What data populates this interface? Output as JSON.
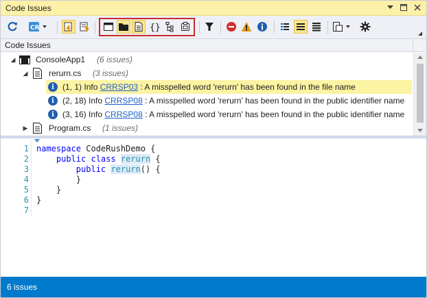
{
  "window": {
    "title": "Code Issues",
    "title_buttons": [
      "dropdown-arrow-icon",
      "maximize-icon",
      "close-icon"
    ]
  },
  "toolbar": {
    "buttons": [
      "refresh-icon",
      "cr-menu-icon",
      "highlight-issues-icon",
      "highlight-file-issues-icon",
      "scope-solution-icon",
      "scope-folder-icon",
      "scope-file-icon",
      "scope-braces-icon",
      "scope-hierarchy-icon",
      "scope-project-icon",
      "filter-icon",
      "error-icon",
      "warning-icon",
      "info-icon",
      "group-by-file-icon",
      "group-by-type-icon",
      "group-flat-icon",
      "export-icon",
      "settings-icon"
    ],
    "accent_active": "#fce58d",
    "accent_scope_box": "#c92b2b"
  },
  "header": {
    "label": "Code Issues"
  },
  "tree": {
    "project": {
      "name": "ConsoleApp1",
      "count": "(6 issues)"
    },
    "files": [
      {
        "name": "rerurn.cs",
        "count": "(3 issues)",
        "expanded": true,
        "issues": [
          {
            "pos": "(1, 1)",
            "severity": "Info",
            "code": "CRRSP03",
            "message": ": A misspelled word 'rerurn' has been found in the file name",
            "selected": true
          },
          {
            "pos": "(2, 18)",
            "severity": "Info",
            "code": "CRRSP08",
            "message": ": A misspelled word 'rerurn' has been found in the public identifier name",
            "selected": false
          },
          {
            "pos": "(3, 16)",
            "severity": "Info",
            "code": "CRRSP08",
            "message": ": A misspelled word 'rerurn' has been found in the public identifier name",
            "selected": false
          }
        ]
      },
      {
        "name": "Program.cs",
        "count": "(1 issues)",
        "expanded": false,
        "issues": []
      }
    ]
  },
  "editor": {
    "line_numbers": [
      "1",
      "2",
      "3",
      "4",
      "5",
      "6",
      "7"
    ],
    "lines": {
      "l1_kw": "namespace",
      "l1_rest": " CodeRushDemo {",
      "l2_indent": "    ",
      "l2_kw": "public class",
      "l2_sp": " ",
      "l2_ident": "rerurn",
      "l2_rest": " {",
      "l3_indent": "        ",
      "l3_kw": "public",
      "l3_sp": " ",
      "l3_ident": "rerurn",
      "l3_rest": "() {",
      "l4": "        }",
      "l5": "    }",
      "l6": "}",
      "l7": ""
    },
    "colors": {
      "keyword": "#0000ff",
      "line_number": "#2b91af",
      "highlight": "#dce9f6"
    }
  },
  "status": {
    "text": "6 issues",
    "color": "#007acc"
  }
}
